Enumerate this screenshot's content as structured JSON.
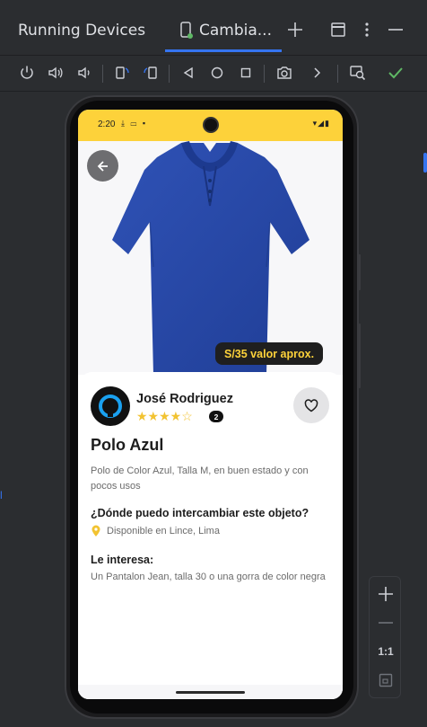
{
  "window": {
    "title": "Running Devices",
    "tab_label": "Cambia..."
  },
  "toolbar": {
    "icons": [
      "power-icon",
      "volume-up-icon",
      "volume-down-icon",
      "rotate-left-icon",
      "rotate-right-icon",
      "back-icon",
      "home-icon",
      "overview-icon",
      "screenshot-icon",
      "more-chevron-icon",
      "device-explorer-icon",
      "check-icon"
    ]
  },
  "device": {
    "status_time": "2:20",
    "status_icons": "⤓ ▭ ▪",
    "status_right": "▾◢▮"
  },
  "app": {
    "price_tag": "S/35 valor aprox.",
    "user_name": "José Rodriguez",
    "stars": "★★★★☆",
    "rating": 4,
    "rating_count": "2",
    "product_title": "Polo Azul",
    "product_desc": "Polo de Color Azul, Talla M, en buen estado y con pocos usos",
    "where_title": "¿Dónde puedo intercambiar este objeto?",
    "location": "Disponible en Lince, Lima",
    "interest_title": "Le interesa:",
    "interest_text": "Un Pantalon Jean, talla 30 o una gorra de color negra"
  },
  "zoom": {
    "one_to_one": "1:1"
  },
  "colors": {
    "accent_yellow": "#fdd23a",
    "shirt_blue": "#2a4aa8",
    "ide_bg": "#2b2d30",
    "ide_accent": "#3574f0"
  }
}
